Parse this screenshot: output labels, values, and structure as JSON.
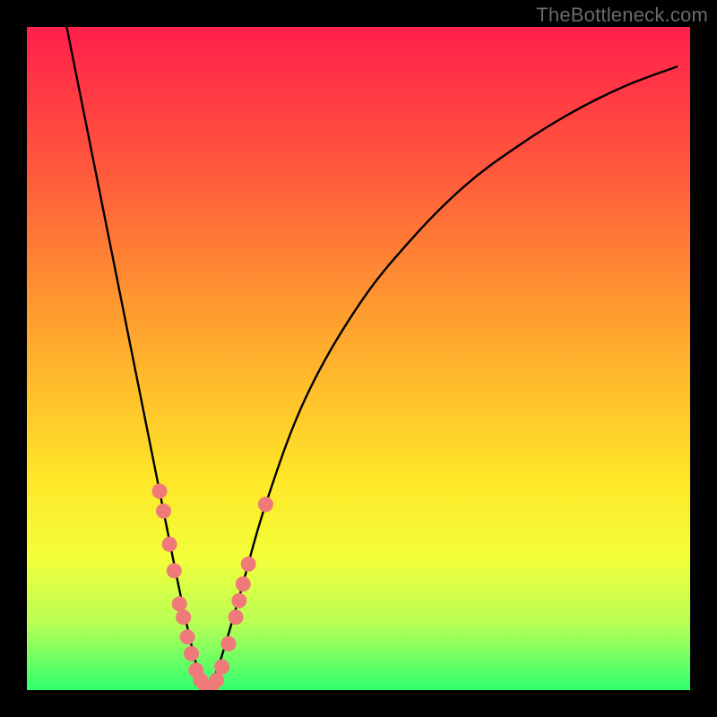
{
  "watermark": "TheBottleneck.com",
  "colors": {
    "frame": "#000000",
    "gradient_top": "#ff1f4b",
    "gradient_bottom": "#2fff6e",
    "curve": "#000000",
    "marker_fill": "#f07a7a",
    "marker_stroke": "#d95b5b"
  },
  "chart_data": {
    "type": "line",
    "title": "",
    "xlabel": "",
    "ylabel": "",
    "xlim": [
      0,
      100
    ],
    "ylim": [
      0,
      100
    ],
    "grid": false,
    "note": "V-shaped bottleneck curve; y ≈ 0 at the optimal match point near x ≈ 27, rising steeply on both sides. Values estimated from pixel positions (no axis ticks shown).",
    "series": [
      {
        "name": "bottleneck-curve",
        "x": [
          6,
          10,
          14,
          18,
          22,
          25,
          27,
          29,
          32,
          36,
          42,
          50,
          58,
          66,
          74,
          82,
          90,
          98
        ],
        "y": [
          100,
          80,
          60,
          40,
          20,
          6,
          0,
          4,
          14,
          28,
          44,
          58,
          68,
          76,
          82,
          87,
          91,
          94
        ]
      }
    ],
    "markers": {
      "name": "highlighted-points",
      "note": "Salmon dots clustered near the bottom of the V and a short way up each arm.",
      "points": [
        {
          "x": 20.0,
          "y": 30.0
        },
        {
          "x": 20.6,
          "y": 27.0
        },
        {
          "x": 21.5,
          "y": 22.0
        },
        {
          "x": 22.2,
          "y": 18.0
        },
        {
          "x": 23.0,
          "y": 13.0
        },
        {
          "x": 23.6,
          "y": 11.0
        },
        {
          "x": 24.2,
          "y": 8.0
        },
        {
          "x": 24.8,
          "y": 5.5
        },
        {
          "x": 25.5,
          "y": 3.0
        },
        {
          "x": 26.2,
          "y": 1.5
        },
        {
          "x": 27.0,
          "y": 0.5
        },
        {
          "x": 27.8,
          "y": 0.5
        },
        {
          "x": 28.6,
          "y": 1.5
        },
        {
          "x": 29.4,
          "y": 3.5
        },
        {
          "x": 30.4,
          "y": 7.0
        },
        {
          "x": 31.5,
          "y": 11.0
        },
        {
          "x": 32.0,
          "y": 13.5
        },
        {
          "x": 32.6,
          "y": 16.0
        },
        {
          "x": 33.4,
          "y": 19.0
        },
        {
          "x": 36.0,
          "y": 28.0
        }
      ]
    }
  }
}
